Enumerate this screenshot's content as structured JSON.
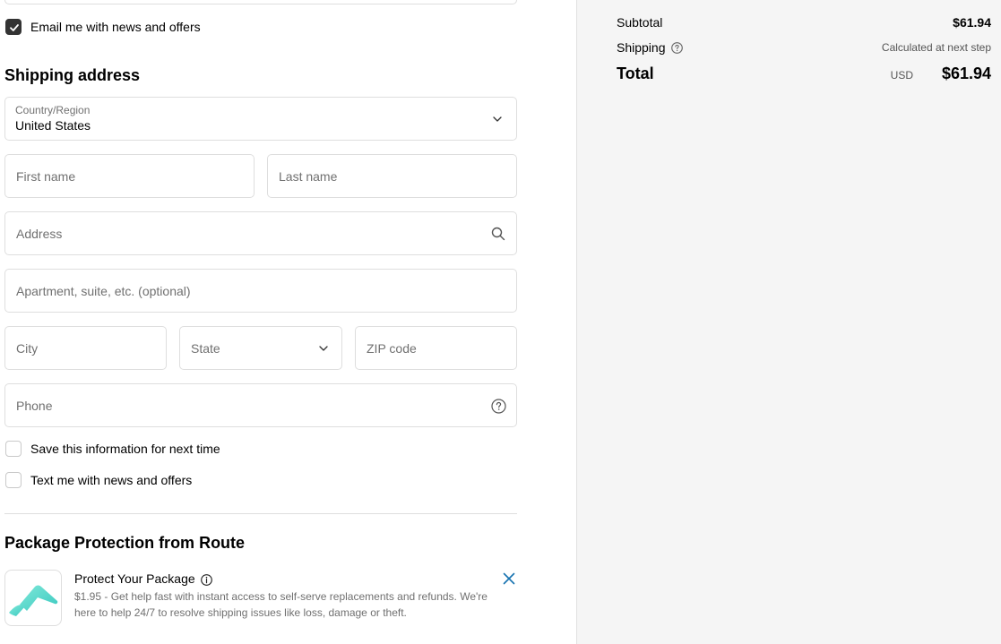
{
  "contact": {
    "email_news_label": "Email me with news and offers",
    "email_news_checked": true
  },
  "shipping": {
    "title": "Shipping address",
    "country_label": "Country/Region",
    "country_value": "United States",
    "first_name_placeholder": "First name",
    "last_name_placeholder": "Last name",
    "address_placeholder": "Address",
    "apartment_placeholder": "Apartment, suite, etc. (optional)",
    "city_placeholder": "City",
    "state_placeholder": "State",
    "zip_placeholder": "ZIP code",
    "phone_placeholder": "Phone",
    "save_info_label": "Save this information for next time",
    "text_news_label": "Text me with news and offers"
  },
  "route": {
    "title": "Package Protection from Route",
    "item_title": "Protect Your Package",
    "item_desc": "$1.95 - Get help fast with instant access to self-serve replacements and refunds. We're here to help 24/7 to resolve shipping issues like loss, damage or theft."
  },
  "summary": {
    "subtotal_label": "Subtotal",
    "subtotal_value": "$61.94",
    "shipping_label": "Shipping",
    "shipping_value": "Calculated at next step",
    "total_label": "Total",
    "currency": "USD",
    "total_value": "$61.94"
  },
  "colors": {
    "accent_link": "#1773b0",
    "checkbox_checked": "#333333",
    "route_teal": "#4fd1c5"
  }
}
